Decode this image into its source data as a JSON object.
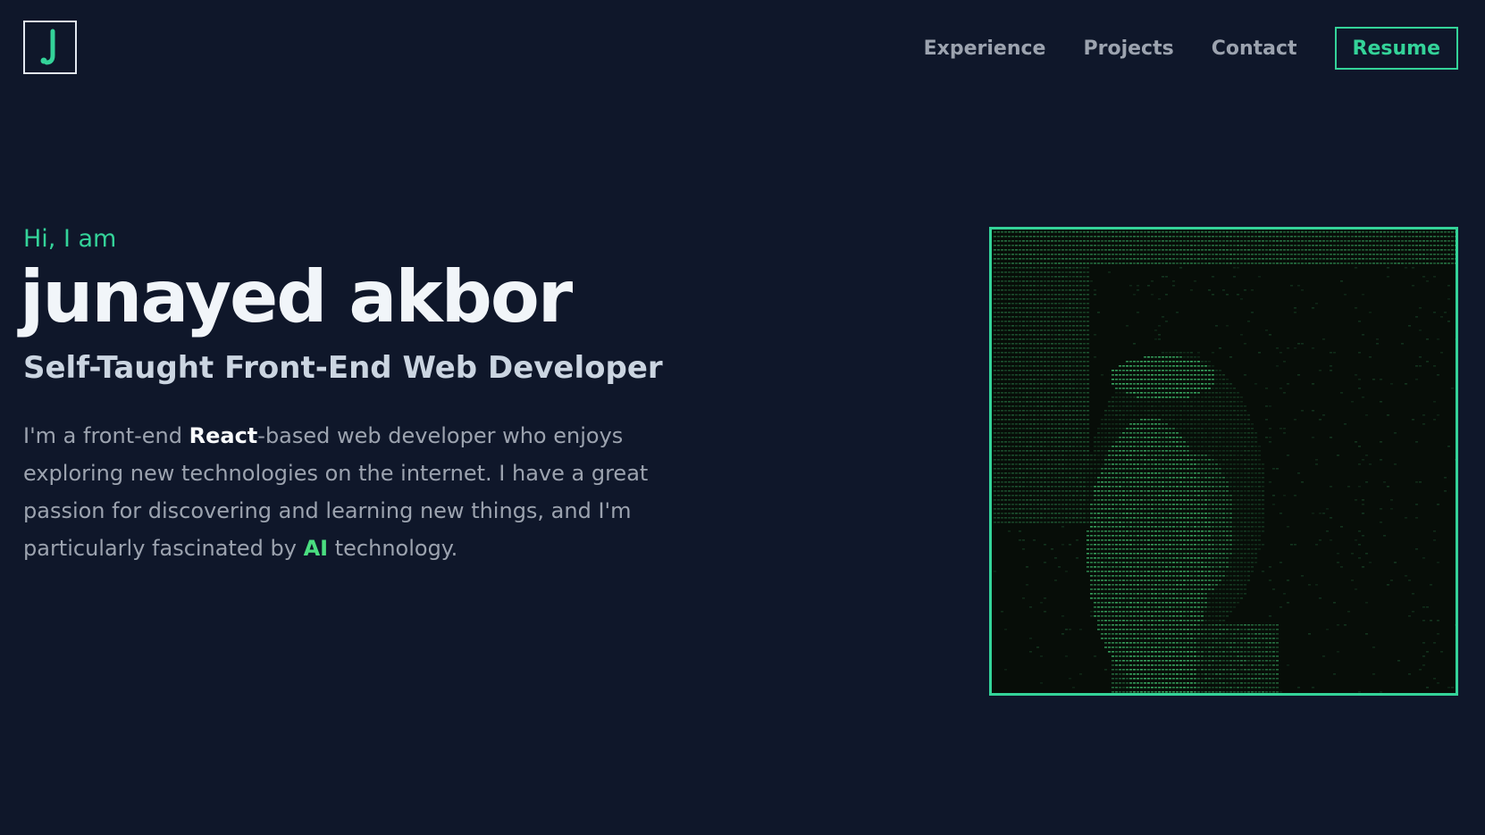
{
  "header": {
    "logo_icon": "j-letter-icon",
    "nav": [
      {
        "label": "Experience"
      },
      {
        "label": "Projects"
      },
      {
        "label": "Contact"
      }
    ],
    "resume_label": "Resume"
  },
  "hero": {
    "greeting": "Hi, I am",
    "name": "junayed akbor",
    "role": "Self-Taught Front-End Web Developer",
    "bio": {
      "part1": "I'm a front-end ",
      "highlight1": "React",
      "part2": "-based web developer who enjoys exploring new technologies on the internet. I have a great passion for discovering and learning new things, and I'm particularly fascinated by ",
      "highlight2": "AI",
      "part3": " technology."
    }
  },
  "portrait": {
    "icon": "ascii-portrait-image"
  },
  "colors": {
    "background": "#0f172a",
    "accent": "#34d399",
    "muted_text": "#9ca3af",
    "heading_text": "#f1f5f9"
  }
}
